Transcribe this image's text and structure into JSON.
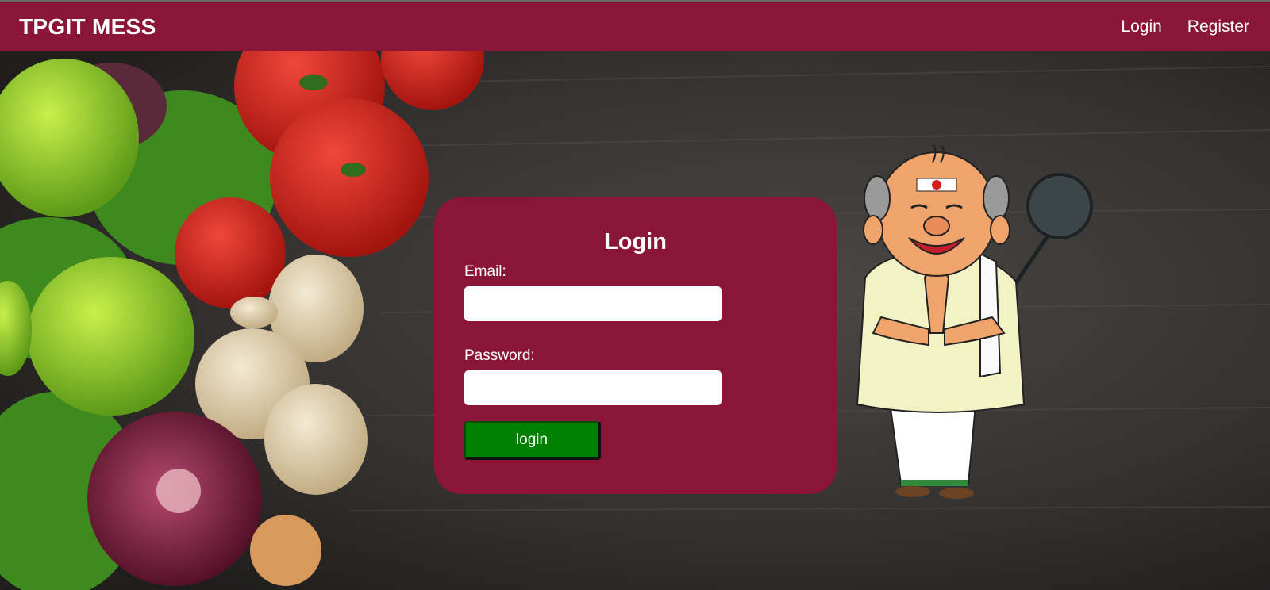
{
  "navbar": {
    "brand": "TPGIT MESS",
    "links": [
      {
        "label": "Login"
      },
      {
        "label": "Register"
      }
    ]
  },
  "login_form": {
    "title": "Login",
    "email_label": "Email:",
    "email_value": "",
    "password_label": "Password:",
    "password_value": "",
    "submit_label": "login"
  },
  "colors": {
    "brand": "#8a1538",
    "button": "#028002",
    "text": "#ffffff"
  },
  "background": {
    "image": "vegetables on dark wooden table",
    "mascot": "cartoon chef greeting with folded hands holding a ladle"
  }
}
